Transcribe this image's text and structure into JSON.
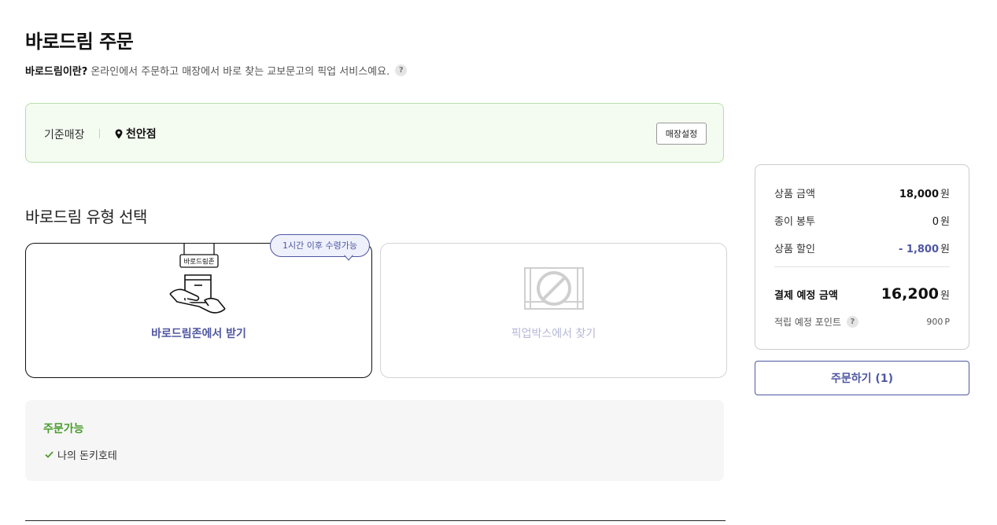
{
  "header": {
    "title": "바로드림 주문",
    "intro_bold": "바로드림이란?",
    "intro_text": "온라인에서 주문하고 매장에서 바로 찾는 교보문고의 픽업 서비스예요.",
    "help_glyph": "?"
  },
  "store": {
    "label": "기준매장",
    "name": "천안점",
    "button_label": "매장설정"
  },
  "pickup_type": {
    "section_title": "바로드림 유형 선택",
    "options": [
      {
        "label": "바로드림존에서 받기",
        "sign": "바로드림존",
        "selected": true,
        "enabled": true
      },
      {
        "label": "픽업박스에서 찾기",
        "selected": false,
        "enabled": false
      }
    ],
    "tooltip": "1시간 이후 수령가능"
  },
  "availability": {
    "title": "주문가능",
    "items": [
      "나의 돈키호테"
    ]
  },
  "summary": {
    "product_amount_label": "상품 금액",
    "product_amount": "18,000",
    "bag_label": "종이 봉투",
    "bag_amount": "0",
    "discount_label": "상품 할인",
    "discount_amount": "- 1,800",
    "total_label": "결제 예정 금액",
    "total_amount": "16,200",
    "currency": "원",
    "points_label": "적립 예정 포인트",
    "points": "900",
    "points_unit": "P",
    "order_button": "주문하기 (1)"
  },
  "colors": {
    "accent": "#4f57a2",
    "available_green": "#4a9c2d",
    "store_border": "#b6dfa9",
    "store_bg": "#f4fbf1"
  }
}
